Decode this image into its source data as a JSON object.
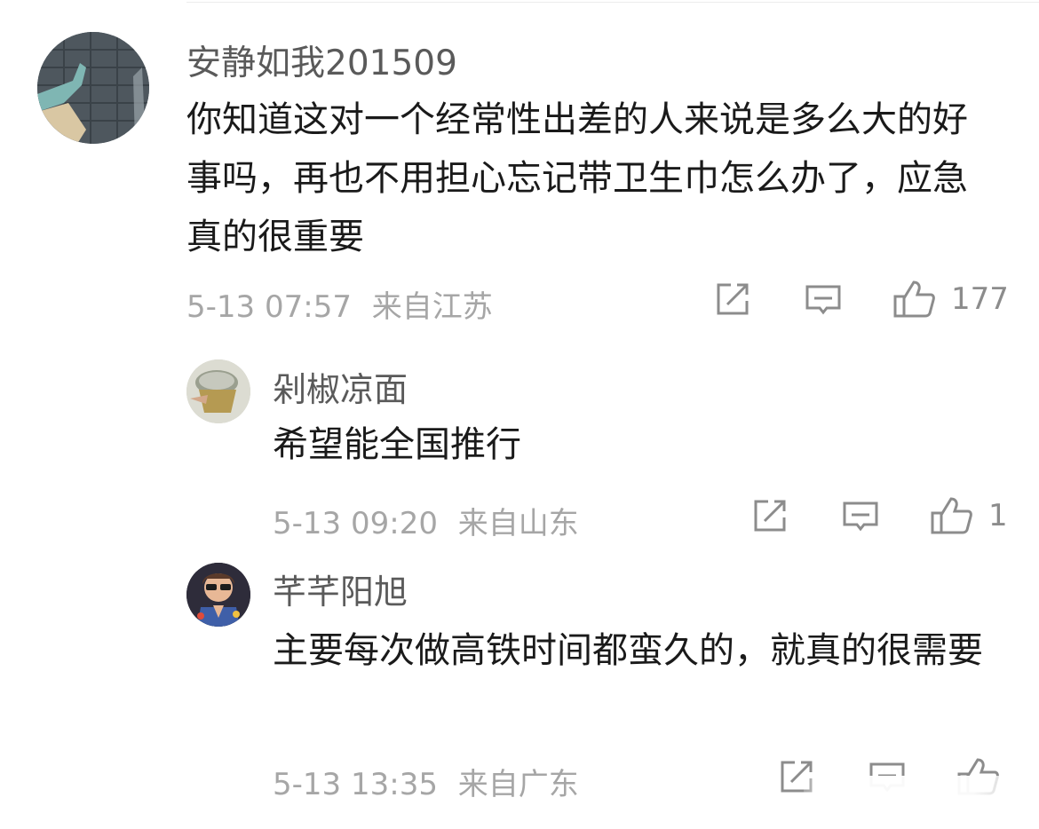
{
  "comments": [
    {
      "username": "安静如我201509",
      "text": "你知道这对一个经常性出差的人来说是多么大的好事吗，再也不用担心忘记带卫生巾怎么办了，应急真的很重要",
      "time": "5-13 07:57",
      "location": "来自江苏",
      "like_count": "177",
      "avatar_icon": "avatar-image"
    },
    {
      "username": "剁椒凉面",
      "text": "希望能全国推行",
      "time": "5-13 09:20",
      "location": "来自山东",
      "like_count": "1",
      "avatar_icon": "avatar-image"
    },
    {
      "username": "芊芊阳旭",
      "text": "主要每次做高铁时间都蛮久的，就真的很需要",
      "time": "5-13 13:35",
      "location": "来自广东",
      "like_count": "",
      "avatar_icon": "avatar-image"
    }
  ],
  "icons": {
    "share": "share-icon",
    "reply": "comment-icon",
    "like": "thumbs-up-icon"
  },
  "colors": {
    "name": "#5a5a5a",
    "text": "#1a1a1a",
    "meta": "#a6a6a6",
    "icon": "#8c8c8c"
  }
}
